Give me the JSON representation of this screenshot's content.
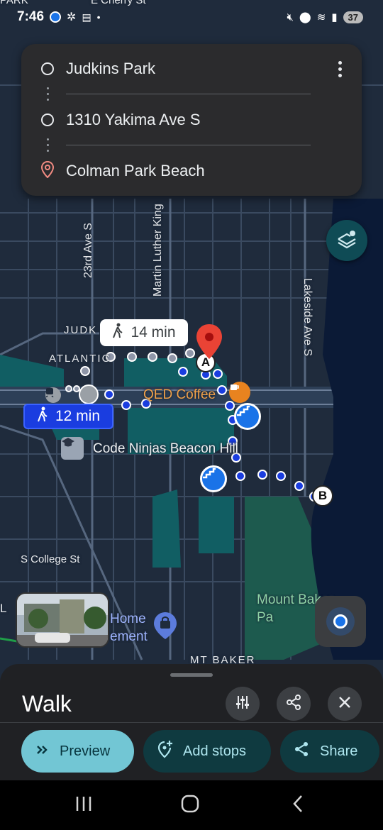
{
  "status_bar": {
    "time": "7:46",
    "battery": "37"
  },
  "map": {
    "labels": {
      "e_cherry": "E Cherry St",
      "park": "PARK",
      "ave_23": "23rd Ave S",
      "mlk": "Martin Luther King",
      "lakeside": "Lakeside Ave S",
      "judk": "JUDK",
      "atlantic": "ATLANTIC",
      "college": "S College St",
      "mt_baker": "MT BAKER",
      "l_edge": "L",
      "home_partial": "Home\nement",
      "park_name": "Mount Baker Pa"
    },
    "pois": {
      "coffee": "QED Coffee",
      "school": "Code Ninjas Beacon Hill"
    },
    "markers": {
      "start": "A",
      "end": "B"
    },
    "colors": {
      "route_primary": "#1a3de0",
      "route_alt": "#9aa6cc",
      "water": "#0b1a36",
      "pin": "#ea4335"
    }
  },
  "directions": {
    "stops": [
      {
        "label": "Judkins Park"
      },
      {
        "label": "1310 Yakima Ave S"
      },
      {
        "label": "Colman Park Beach"
      }
    ]
  },
  "route_badges": {
    "alt": "14 min",
    "primary": "12 min"
  },
  "sheet": {
    "title": "Walk",
    "buttons": {
      "preview": "Preview",
      "add_stops": "Add stops",
      "share": "Share"
    }
  },
  "icons": [
    "walk-icon",
    "layers-icon",
    "tune-icon",
    "share-icon",
    "close-icon",
    "more-icon",
    "place-pin-icon",
    "stairs-icon",
    "coffee-icon",
    "school-icon",
    "transit-icon",
    "my-location-icon",
    "recents-icon",
    "home-icon",
    "back-icon"
  ]
}
